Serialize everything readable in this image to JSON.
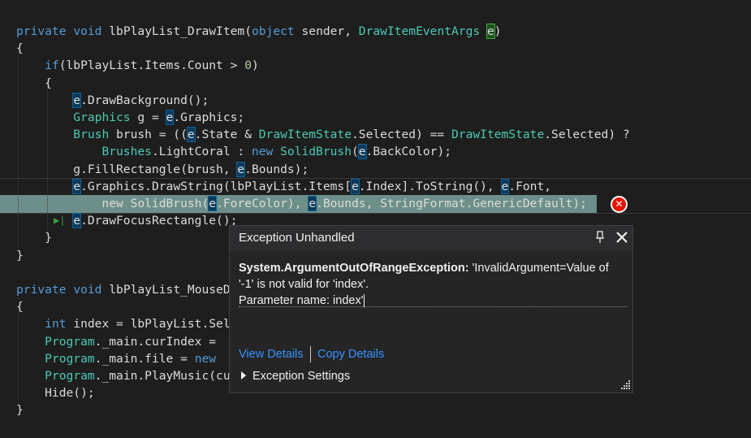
{
  "editor": {
    "lines": [
      {
        "id": "l1",
        "tokens": [
          {
            "t": "private",
            "c": "kw"
          },
          {
            "t": " "
          },
          {
            "t": "void",
            "c": "kw"
          },
          {
            "t": " "
          },
          {
            "t": "lbPlayList_DrawItem",
            "c": "squiggle"
          },
          {
            "t": "("
          },
          {
            "t": "object",
            "c": "kw"
          },
          {
            "t": " sender, "
          },
          {
            "t": "DrawItemEventArgs",
            "c": "type"
          },
          {
            "t": " "
          },
          {
            "t": "e",
            "c": "e-green"
          },
          {
            "t": ")"
          }
        ]
      },
      {
        "id": "l2",
        "tokens": [
          {
            "t": "{"
          }
        ]
      },
      {
        "id": "l3",
        "tokens": [
          {
            "t": "    "
          },
          {
            "t": "if",
            "c": "kw"
          },
          {
            "t": "(lbPlayList.Items.Count > "
          },
          {
            "t": "0",
            "c": "num"
          },
          {
            "t": ")"
          }
        ]
      },
      {
        "id": "l4",
        "tokens": [
          {
            "t": "    {"
          }
        ]
      },
      {
        "id": "l5",
        "tokens": [
          {
            "t": "        "
          },
          {
            "t": "e",
            "c": "e"
          },
          {
            "t": ".DrawBackground();"
          }
        ]
      },
      {
        "id": "l6",
        "tokens": [
          {
            "t": "        "
          },
          {
            "t": "Graphics",
            "c": "type"
          },
          {
            "t": " g = "
          },
          {
            "t": "e",
            "c": "e"
          },
          {
            "t": ".Graphics;"
          }
        ]
      },
      {
        "id": "l7",
        "tokens": [
          {
            "t": "        "
          },
          {
            "t": "Brush",
            "c": "type"
          },
          {
            "t": " brush = (("
          },
          {
            "t": "e",
            "c": "e"
          },
          {
            "t": ".State & "
          },
          {
            "t": "DrawItemState",
            "c": "type"
          },
          {
            "t": ".Selected) == "
          },
          {
            "t": "DrawItemState",
            "c": "type"
          },
          {
            "t": ".Selected) ?"
          }
        ]
      },
      {
        "id": "l8",
        "tokens": [
          {
            "t": "            "
          },
          {
            "t": "Brushes",
            "c": "type"
          },
          {
            "t": ".LightCoral : "
          },
          {
            "t": "new",
            "c": "kw"
          },
          {
            "t": " "
          },
          {
            "t": "SolidBrush",
            "c": "type"
          },
          {
            "t": "("
          },
          {
            "t": "e",
            "c": "e"
          },
          {
            "t": ".BackColor);"
          }
        ]
      },
      {
        "id": "l9",
        "tokens": [
          {
            "t": "        g.FillRectangle(brush, "
          },
          {
            "t": "e",
            "c": "e"
          },
          {
            "t": ".Bounds);"
          }
        ]
      },
      {
        "id": "l10",
        "tokens": [
          {
            "t": "        "
          },
          {
            "t": "e",
            "c": "e"
          },
          {
            "t": ".Graphics.DrawString(lbPlayList.Items["
          },
          {
            "t": "e",
            "c": "e"
          },
          {
            "t": ".Index].ToString(), "
          },
          {
            "t": "e",
            "c": "e"
          },
          {
            "t": ".Font,"
          }
        ]
      },
      {
        "id": "l11",
        "tokens": [
          {
            "t": "            new SolidBrush("
          },
          {
            "t": "e",
            "c": "e"
          },
          {
            "t": ".ForeColor), "
          },
          {
            "t": "e",
            "c": "e"
          },
          {
            "t": ".Bounds, StringFormat.GenericDefault);"
          }
        ]
      },
      {
        "id": "l12",
        "tokens": [
          {
            "t": "        "
          },
          {
            "t": "e",
            "c": "e"
          },
          {
            "t": ".DrawFocusRectangle();"
          }
        ]
      },
      {
        "id": "l13",
        "tokens": [
          {
            "t": "    }"
          }
        ]
      },
      {
        "id": "l14",
        "tokens": [
          {
            "t": "}"
          }
        ]
      },
      {
        "id": "l15",
        "tokens": [
          {
            "t": ""
          }
        ]
      },
      {
        "id": "l16",
        "tokens": [
          {
            "t": "private",
            "c": "kw"
          },
          {
            "t": " "
          },
          {
            "t": "void",
            "c": "kw"
          },
          {
            "t": " "
          },
          {
            "t": "lbPlayList_MouseD",
            "c": "squiggle"
          }
        ]
      },
      {
        "id": "l17",
        "tokens": [
          {
            "t": "{"
          }
        ]
      },
      {
        "id": "l18",
        "tokens": [
          {
            "t": "    "
          },
          {
            "t": "int",
            "c": "kw"
          },
          {
            "t": " index = lbPlayList.Sel"
          }
        ]
      },
      {
        "id": "l19",
        "tokens": [
          {
            "t": "    "
          },
          {
            "t": "Program",
            "c": "type"
          },
          {
            "t": "._main.curIndex = "
          }
        ]
      },
      {
        "id": "l20",
        "tokens": [
          {
            "t": "    "
          },
          {
            "t": "Program",
            "c": "type"
          },
          {
            "t": "._main.file = "
          },
          {
            "t": "new",
            "c": "kw"
          },
          {
            "t": " "
          }
        ]
      },
      {
        "id": "l21",
        "tokens": [
          {
            "t": "    "
          },
          {
            "t": "Program",
            "c": "type"
          },
          {
            "t": "._main.PlayMusic(cu"
          }
        ]
      },
      {
        "id": "l22",
        "tokens": [
          {
            "t": "    Hide();"
          }
        ]
      },
      {
        "id": "l23",
        "tokens": [
          {
            "t": "}"
          }
        ]
      }
    ]
  },
  "error_glyph": "✕",
  "next_statement_glyph": "▶|",
  "exception_popup": {
    "title": "Exception Unhandled",
    "pin_icon": "pin-icon",
    "close_icon": "close-icon",
    "exception_type": "System.ArgumentOutOfRangeException:",
    "message_1": " 'InvalidArgument=Value of '-1' is not valid for 'index'.",
    "message_2": "Parameter name: index'",
    "view_details": "View Details",
    "copy_details": "Copy Details",
    "exception_settings": "Exception Settings"
  },
  "colors": {
    "background": "#1e1e1e",
    "keyword": "#569cd6",
    "type": "#4ec9b0",
    "number": "#b5cea8",
    "highlight_band": "#6c8f8a",
    "error_red": "#e51400",
    "link": "#3794ff"
  }
}
